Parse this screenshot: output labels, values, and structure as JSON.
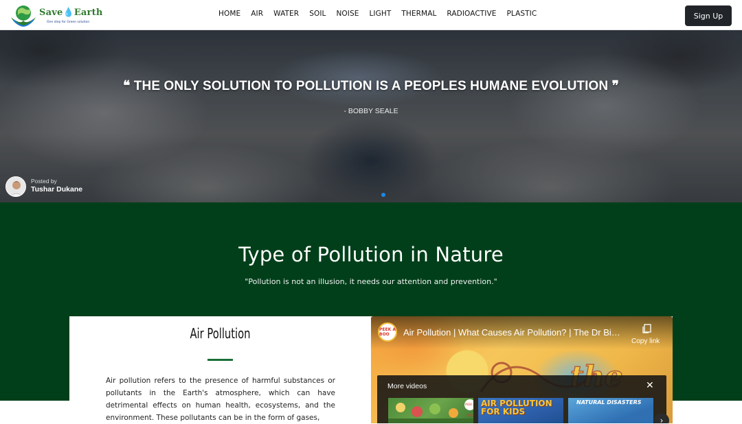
{
  "brand": {
    "title_part1": "Save",
    "title_part2": "Earth",
    "tagline": "One step for Green solution",
    "logo_icon": "earth-hands-icon",
    "colors": {
      "green": "#2f7a2f",
      "blue": "#1f7bd6"
    }
  },
  "nav": {
    "items": [
      "HOME",
      "AIR",
      "WATER",
      "SOIL",
      "NOISE",
      "LIGHT",
      "THERMAL",
      "RADIOACTIVE",
      "PLASTIC"
    ],
    "signup_label": "Sign Up"
  },
  "hero": {
    "quote": "❝ THE ONLY SOLUTION TO POLLUTION IS A PEOPLES HUMANE EVOLUTION ❞",
    "author": "- BOBBY SEALE",
    "posted_by_label": "Posted by",
    "poster_name": "Tushar Dukane"
  },
  "section": {
    "title": "Type of Pollution in Nature",
    "subtitle": "\"Pollution is not an illusion, it needs our attention and prevention.\"",
    "background": "#003f1a"
  },
  "card": {
    "title": "Air Pollution",
    "text": "Air pollution refers to the presence of harmful substances or pollutants in the Earth's atmosphere, which can have detrimental effects on human health, ecosystems, and the environment. These pollutants can be in the form of gases,"
  },
  "video": {
    "channel_badge": "PEEK A BOO",
    "title": "Air Pollution | What Causes Air Pollution? | The Dr Binocs Show",
    "copy_label": "Copy link",
    "more_label": "More videos",
    "close_glyph": "✕",
    "thumbnails": [
      {
        "text": "",
        "kind": "garden"
      },
      {
        "text": "AIR POLLUTION FOR KIDS",
        "kind": "air"
      },
      {
        "text": "NATURAL DISASTERS",
        "kind": "disaster"
      }
    ],
    "next_glyph": "›"
  }
}
